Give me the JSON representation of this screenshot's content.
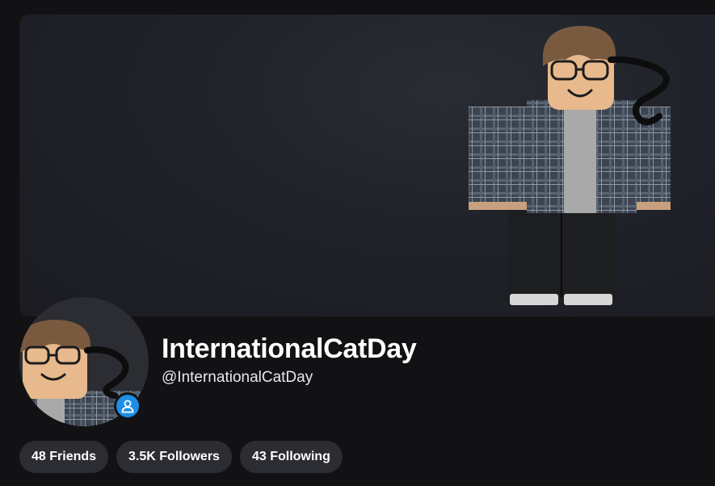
{
  "profile": {
    "display_name": "InternationalCatDay",
    "username": "@InternationalCatDay"
  },
  "stats": [
    {
      "label": "48 Friends"
    },
    {
      "label": "3.5K Followers"
    },
    {
      "label": "43 Following"
    }
  ],
  "icons": {
    "presence": "person-icon"
  },
  "colors": {
    "background": "#121215",
    "banner": "#20222a",
    "pill": "#2b2d33",
    "presence_badge": "#1e8fe6"
  }
}
